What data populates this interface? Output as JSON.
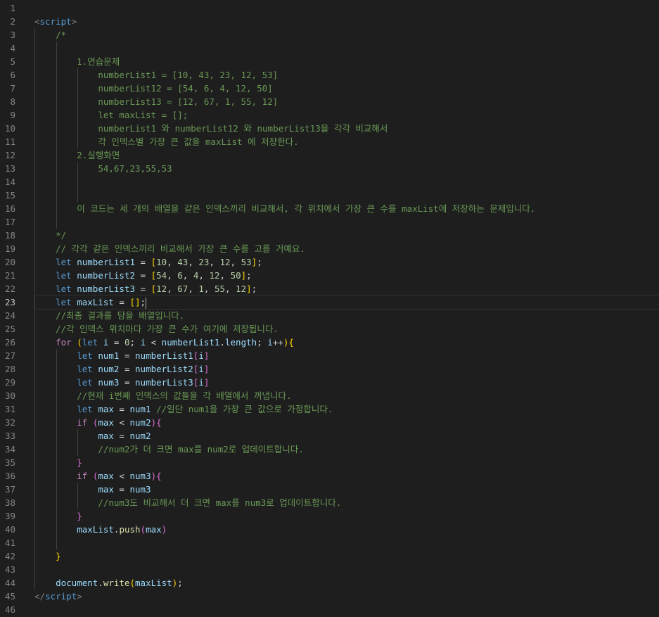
{
  "editor": {
    "active_line": 23,
    "lines": [
      {
        "n": 1,
        "indent": 0,
        "t": []
      },
      {
        "n": 2,
        "indent": 0,
        "t": [
          [
            "<",
            "br"
          ],
          [
            "script",
            "tag"
          ],
          [
            ">",
            "br"
          ]
        ]
      },
      {
        "n": 3,
        "indent": 1,
        "t": [
          [
            "/*",
            "cm"
          ]
        ]
      },
      {
        "n": 4,
        "indent": 2,
        "t": []
      },
      {
        "n": 5,
        "indent": 2,
        "t": [
          [
            "1.연습문제",
            "cm"
          ]
        ]
      },
      {
        "n": 6,
        "indent": 3,
        "t": [
          [
            "numberList1 = [10, 43, 23, 12, 53]",
            "cm"
          ]
        ]
      },
      {
        "n": 7,
        "indent": 3,
        "t": [
          [
            "numberList12 = [54, 6, 4, 12, 50]",
            "cm"
          ]
        ]
      },
      {
        "n": 8,
        "indent": 3,
        "t": [
          [
            "numberList13 = [12, 67, 1, 55, 12]",
            "cm"
          ]
        ]
      },
      {
        "n": 9,
        "indent": 3,
        "t": [
          [
            "let maxList = [];",
            "cm"
          ]
        ]
      },
      {
        "n": 10,
        "indent": 3,
        "t": [
          [
            "numberList1 와 numberList12 와 numberList13을 각각 비교해서",
            "cm"
          ]
        ]
      },
      {
        "n": 11,
        "indent": 3,
        "t": [
          [
            "각 인덱스별 가장 큰 값을 maxList 에 저장한다.",
            "cm"
          ]
        ]
      },
      {
        "n": 12,
        "indent": 2,
        "t": [
          [
            "2.실행화면",
            "cm"
          ]
        ]
      },
      {
        "n": 13,
        "indent": 3,
        "t": [
          [
            "54,67,23,55,53",
            "cm"
          ]
        ]
      },
      {
        "n": 14,
        "indent": 3,
        "t": []
      },
      {
        "n": 15,
        "indent": 3,
        "t": []
      },
      {
        "n": 16,
        "indent": 2,
        "t": [
          [
            "이 코드는 세 개의 배열을 같은 인덱스끼리 비교해서, 각 위치에서 가장 큰 수를 maxList에 저장하는 문제입니다.",
            "cm"
          ]
        ]
      },
      {
        "n": 17,
        "indent": 2,
        "t": []
      },
      {
        "n": 18,
        "indent": 1,
        "t": [
          [
            "*/",
            "cm"
          ]
        ]
      },
      {
        "n": 19,
        "indent": 1,
        "t": [
          [
            "// 각각 같은 인덱스끼리 비교해서 가장 큰 수를 고를 거예요.",
            "cm"
          ]
        ]
      },
      {
        "n": 20,
        "indent": 1,
        "t": [
          [
            "let",
            "kw"
          ],
          [
            " ",
            "op"
          ],
          [
            "numberList1",
            "var"
          ],
          [
            " = ",
            "op"
          ],
          [
            "[",
            "b1"
          ],
          [
            "10",
            "num"
          ],
          [
            ", ",
            "op"
          ],
          [
            "43",
            "num"
          ],
          [
            ", ",
            "op"
          ],
          [
            "23",
            "num"
          ],
          [
            ", ",
            "op"
          ],
          [
            "12",
            "num"
          ],
          [
            ", ",
            "op"
          ],
          [
            "53",
            "num"
          ],
          [
            "]",
            "b1"
          ],
          [
            ";",
            "op"
          ]
        ]
      },
      {
        "n": 21,
        "indent": 1,
        "t": [
          [
            "let",
            "kw"
          ],
          [
            " ",
            "op"
          ],
          [
            "numberList2",
            "var"
          ],
          [
            " = ",
            "op"
          ],
          [
            "[",
            "b1"
          ],
          [
            "54",
            "num"
          ],
          [
            ", ",
            "op"
          ],
          [
            "6",
            "num"
          ],
          [
            ", ",
            "op"
          ],
          [
            "4",
            "num"
          ],
          [
            ", ",
            "op"
          ],
          [
            "12",
            "num"
          ],
          [
            ", ",
            "op"
          ],
          [
            "50",
            "num"
          ],
          [
            "]",
            "b1"
          ],
          [
            ";",
            "op"
          ]
        ]
      },
      {
        "n": 22,
        "indent": 1,
        "t": [
          [
            "let",
            "kw"
          ],
          [
            " ",
            "op"
          ],
          [
            "numberList3",
            "var"
          ],
          [
            " = ",
            "op"
          ],
          [
            "[",
            "b1"
          ],
          [
            "12",
            "num"
          ],
          [
            ", ",
            "op"
          ],
          [
            "67",
            "num"
          ],
          [
            ", ",
            "op"
          ],
          [
            "1",
            "num"
          ],
          [
            ", ",
            "op"
          ],
          [
            "55",
            "num"
          ],
          [
            ", ",
            "op"
          ],
          [
            "12",
            "num"
          ],
          [
            "]",
            "b1"
          ],
          [
            ";",
            "op"
          ]
        ]
      },
      {
        "n": 23,
        "indent": 1,
        "t": [
          [
            "let",
            "kw"
          ],
          [
            " ",
            "op"
          ],
          [
            "maxList",
            "var"
          ],
          [
            " = ",
            "op"
          ],
          [
            "[]",
            "b1"
          ],
          [
            ";",
            "op"
          ]
        ]
      },
      {
        "n": 24,
        "indent": 1,
        "t": [
          [
            "//최종 결과를 담을 배열입니다.",
            "cm"
          ]
        ]
      },
      {
        "n": 25,
        "indent": 1,
        "t": [
          [
            "//각 인덱스 위치마다 가장 큰 수가 여기에 저장됩니다.",
            "cm"
          ]
        ]
      },
      {
        "n": 26,
        "indent": 1,
        "t": [
          [
            "for",
            "ctl"
          ],
          [
            " ",
            "op"
          ],
          [
            "(",
            "b1"
          ],
          [
            "let",
            "kw"
          ],
          [
            " ",
            "op"
          ],
          [
            "i",
            "var"
          ],
          [
            " = ",
            "op"
          ],
          [
            "0",
            "num"
          ],
          [
            "; ",
            "op"
          ],
          [
            "i",
            "var"
          ],
          [
            " < ",
            "op"
          ],
          [
            "numberList1",
            "var"
          ],
          [
            ".",
            "op"
          ],
          [
            "length",
            "var"
          ],
          [
            "; ",
            "op"
          ],
          [
            "i",
            "var"
          ],
          [
            "++",
            "op"
          ],
          [
            ")",
            "b1"
          ],
          [
            "{",
            "b1"
          ]
        ]
      },
      {
        "n": 27,
        "indent": 2,
        "t": [
          [
            "let",
            "kw"
          ],
          [
            " ",
            "op"
          ],
          [
            "num1",
            "var"
          ],
          [
            " = ",
            "op"
          ],
          [
            "numberList1",
            "var"
          ],
          [
            "[",
            "b2"
          ],
          [
            "i",
            "var"
          ],
          [
            "]",
            "b2"
          ]
        ]
      },
      {
        "n": 28,
        "indent": 2,
        "t": [
          [
            "let",
            "kw"
          ],
          [
            " ",
            "op"
          ],
          [
            "num2",
            "var"
          ],
          [
            " = ",
            "op"
          ],
          [
            "numberList2",
            "var"
          ],
          [
            "[",
            "b2"
          ],
          [
            "i",
            "var"
          ],
          [
            "]",
            "b2"
          ]
        ]
      },
      {
        "n": 29,
        "indent": 2,
        "t": [
          [
            "let",
            "kw"
          ],
          [
            " ",
            "op"
          ],
          [
            "num3",
            "var"
          ],
          [
            " = ",
            "op"
          ],
          [
            "numberList3",
            "var"
          ],
          [
            "[",
            "b2"
          ],
          [
            "i",
            "var"
          ],
          [
            "]",
            "b2"
          ]
        ]
      },
      {
        "n": 30,
        "indent": 2,
        "t": [
          [
            "//현재 i번째 인덱스의 값들을 각 배열에서 꺼냅니다.",
            "cm"
          ]
        ]
      },
      {
        "n": 31,
        "indent": 2,
        "t": [
          [
            "let",
            "kw"
          ],
          [
            " ",
            "op"
          ],
          [
            "max",
            "var"
          ],
          [
            " = ",
            "op"
          ],
          [
            "num1",
            "var"
          ],
          [
            " ",
            "op"
          ],
          [
            "//일단 num1을 가장 큰 값으로 가정합니다.",
            "cm"
          ]
        ]
      },
      {
        "n": 32,
        "indent": 2,
        "t": [
          [
            "if",
            "ctl"
          ],
          [
            " ",
            "op"
          ],
          [
            "(",
            "b2"
          ],
          [
            "max",
            "var"
          ],
          [
            " < ",
            "op"
          ],
          [
            "num2",
            "var"
          ],
          [
            ")",
            "b2"
          ],
          [
            "{",
            "b2"
          ]
        ]
      },
      {
        "n": 33,
        "indent": 3,
        "t": [
          [
            "max",
            "var"
          ],
          [
            " = ",
            "op"
          ],
          [
            "num2",
            "var"
          ]
        ]
      },
      {
        "n": 34,
        "indent": 3,
        "t": [
          [
            "//num2가 더 크면 max를 num2로 업데이트합니다.",
            "cm"
          ]
        ]
      },
      {
        "n": 35,
        "indent": 2,
        "t": [
          [
            "}",
            "b2"
          ]
        ]
      },
      {
        "n": 36,
        "indent": 2,
        "t": [
          [
            "if",
            "ctl"
          ],
          [
            " ",
            "op"
          ],
          [
            "(",
            "b2"
          ],
          [
            "max",
            "var"
          ],
          [
            " < ",
            "op"
          ],
          [
            "num3",
            "var"
          ],
          [
            ")",
            "b2"
          ],
          [
            "{",
            "b2"
          ]
        ]
      },
      {
        "n": 37,
        "indent": 3,
        "t": [
          [
            "max",
            "var"
          ],
          [
            " = ",
            "op"
          ],
          [
            "num3",
            "var"
          ]
        ]
      },
      {
        "n": 38,
        "indent": 3,
        "t": [
          [
            "//num3도 비교해서 더 크면 max를 num3로 업데이트합니다.",
            "cm"
          ]
        ]
      },
      {
        "n": 39,
        "indent": 2,
        "t": [
          [
            "}",
            "b2"
          ]
        ]
      },
      {
        "n": 40,
        "indent": 2,
        "t": [
          [
            "maxList",
            "var"
          ],
          [
            ".",
            "op"
          ],
          [
            "push",
            "fn"
          ],
          [
            "(",
            "b2"
          ],
          [
            "max",
            "var"
          ],
          [
            ")",
            "b2"
          ]
        ]
      },
      {
        "n": 41,
        "indent": 2,
        "t": []
      },
      {
        "n": 42,
        "indent": 1,
        "t": [
          [
            "}",
            "b1"
          ]
        ]
      },
      {
        "n": 43,
        "indent": 1,
        "t": []
      },
      {
        "n": 44,
        "indent": 1,
        "t": [
          [
            "document",
            "var"
          ],
          [
            ".",
            "op"
          ],
          [
            "write",
            "fn"
          ],
          [
            "(",
            "b1"
          ],
          [
            "maxList",
            "var"
          ],
          [
            ")",
            "b1"
          ],
          [
            ";",
            "op"
          ]
        ]
      },
      {
        "n": 45,
        "indent": 0,
        "t": [
          [
            "</",
            "br"
          ],
          [
            "script",
            "tag"
          ],
          [
            ">",
            "br"
          ]
        ]
      },
      {
        "n": 46,
        "indent": 0,
        "t": []
      }
    ]
  },
  "colors": {
    "background": "#1e1e1e",
    "line_number": "#858585",
    "comment": "#6a9955",
    "keyword": "#569cd6",
    "control": "#c586c0",
    "variable": "#9cdcfe",
    "number": "#b5cea8",
    "function": "#dcdcaa"
  }
}
